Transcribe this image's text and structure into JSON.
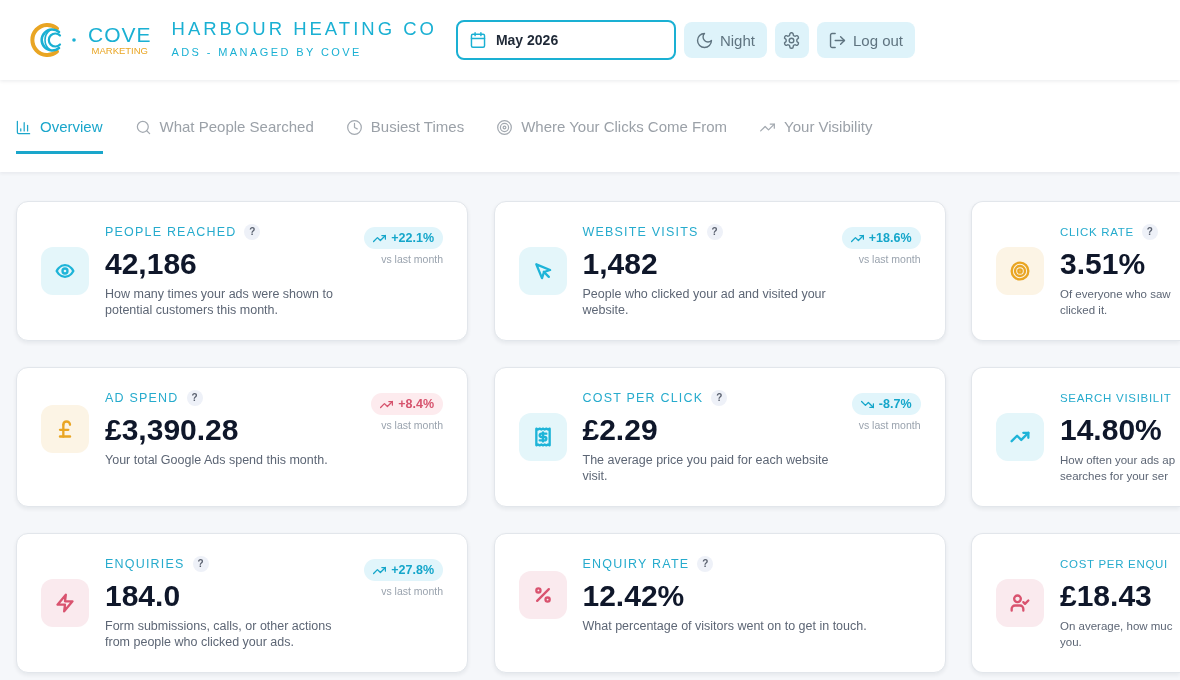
{
  "header": {
    "logo": {
      "wordmark": "COVE",
      "tagline": "MARKETING"
    },
    "client": {
      "name": "HARBOUR HEATING CO",
      "subtitle": "ADS - MANAGED BY COVE"
    },
    "month_picker": {
      "value": "May 2026"
    },
    "buttons": [
      {
        "kind": "theme",
        "label": "Night"
      },
      {
        "kind": "settings"
      },
      {
        "kind": "logout",
        "label": "Log out"
      }
    ]
  },
  "tabs": [
    {
      "label": "Overview",
      "selected": true
    },
    {
      "label": "What People Searched",
      "selected": false
    },
    {
      "label": "Busiest Times",
      "selected": false
    },
    {
      "label": "Where Your Clicks Come From",
      "selected": false
    },
    {
      "label": "Your Visibility",
      "selected": false
    }
  ],
  "cards": [
    {
      "title": "PEOPLE REACHED",
      "help": "?",
      "value": "42,186",
      "description_lines": [
        "How many times your ads were shown to",
        "potential customers this month."
      ],
      "color": "#1eb4d8",
      "change": {
        "text": "+22.1%",
        "rising": true,
        "favourable": true,
        "note": "vs last month"
      }
    },
    {
      "title": "WEBSITE VISITS",
      "help": "?",
      "value": "1,482",
      "description_lines": [
        "People who clicked your ad and visited your",
        "website."
      ],
      "color": "#1eb4d8",
      "change": {
        "text": "+18.6%",
        "rising": true,
        "favourable": true,
        "note": "vs last month"
      }
    },
    {
      "title": "CLICK RATE",
      "help": "?",
      "value": "3.51%",
      "description_lines": [
        "Of everyone who saw",
        "clicked it."
      ],
      "color": "#e9a523"
    },
    {
      "title": "AD SPEND",
      "help": "?",
      "value": "£3,390.28",
      "description_lines": [
        "Your total Google Ads spend this month."
      ],
      "color": "#e9a523",
      "change": {
        "text": "+8.4%",
        "rising": true,
        "favourable": false,
        "note": "vs last month"
      }
    },
    {
      "title": "COST PER CLICK",
      "help": "?",
      "value": "£2.29",
      "description_lines": [
        "The average price you paid for each website",
        "visit."
      ],
      "color": "#1eb4d8",
      "change": {
        "text": "-8.7%",
        "rising": false,
        "favourable": true,
        "note": "vs last month"
      }
    },
    {
      "title": "SEARCH VISIBILIT",
      "value": "14.80%",
      "description_lines": [
        "How often your ads ap",
        "searches for your ser"
      ],
      "color": "#1eb4d8"
    },
    {
      "title": "ENQUIRIES",
      "help": "?",
      "value": "184.0",
      "description_lines": [
        "Form submissions, calls, or other actions",
        "from people who clicked your ads."
      ],
      "color": "#d9536f",
      "change": {
        "text": "+27.8%",
        "rising": true,
        "favourable": true,
        "note": "vs last month"
      }
    },
    {
      "title": "ENQUIRY RATE",
      "help": "?",
      "value": "12.42%",
      "description_lines": [
        "What percentage of visitors went on to get in touch."
      ],
      "color": "#d9536f"
    },
    {
      "title": "COST PER ENQUI",
      "value": "£18.43",
      "description_lines": [
        "On average, how muc",
        "you."
      ],
      "color": "#d9536f"
    }
  ]
}
